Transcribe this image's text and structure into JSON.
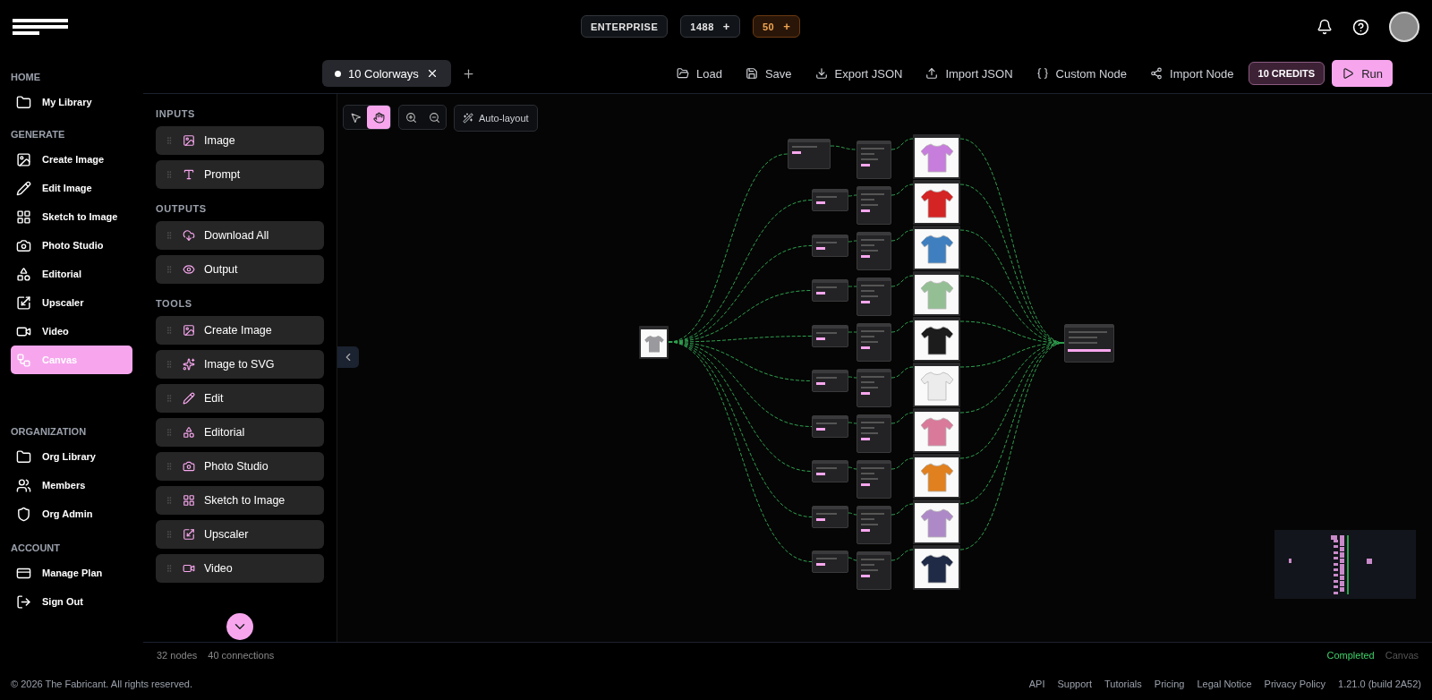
{
  "header": {
    "badges": [
      {
        "kind": "plan",
        "label": "ENTERPRISE"
      },
      {
        "kind": "credits",
        "label": "1488",
        "action": "+"
      },
      {
        "kind": "bonus",
        "label": "50",
        "action": "+"
      }
    ]
  },
  "sidebar": {
    "sections": [
      {
        "title": "HOME",
        "items": [
          {
            "label": "My Library",
            "selected": false
          }
        ]
      },
      {
        "title": "GENERATE",
        "items": [
          {
            "label": "Create Image",
            "selected": false
          },
          {
            "label": "Edit Image",
            "selected": false
          },
          {
            "label": "Sketch to Image",
            "selected": false
          },
          {
            "label": "Photo Studio",
            "selected": false
          },
          {
            "label": "Editorial",
            "selected": false
          },
          {
            "label": "Upscaler",
            "selected": false
          },
          {
            "label": "Video",
            "selected": false
          },
          {
            "label": "Canvas",
            "selected": true
          }
        ]
      },
      {
        "title": "ORGANIZATION",
        "items": [
          {
            "label": "Org Library",
            "selected": false
          },
          {
            "label": "Members",
            "selected": false
          },
          {
            "label": "Org Admin",
            "selected": false
          }
        ]
      },
      {
        "title": "ACCOUNT",
        "items": [
          {
            "label": "Manage Plan",
            "selected": false
          },
          {
            "label": "Sign Out",
            "selected": false
          }
        ]
      }
    ]
  },
  "tabs": [
    {
      "label": "10 Colorways",
      "selected": true,
      "modified": true
    }
  ],
  "actions": [
    "Load",
    "Save",
    "Export JSON",
    "Import JSON",
    "Custom Node",
    "Import Node"
  ],
  "credits": "10 CREDITS",
  "run": "Run",
  "panel": {
    "sections": [
      {
        "title": "INPUTS",
        "items": [
          "Image",
          "Prompt"
        ]
      },
      {
        "title": "OUTPUTS",
        "items": [
          "Download All",
          "Output"
        ]
      },
      {
        "title": "TOOLS",
        "items": [
          "Create Image",
          "Image to SVG",
          "Edit",
          "Editorial",
          "Photo Studio",
          "Sketch to Image",
          "Upscaler",
          "Video"
        ]
      }
    ]
  },
  "canvas_toolbar": {
    "tools": [
      {
        "kind": "select",
        "selected": false
      },
      {
        "kind": "pan",
        "selected": true
      }
    ],
    "auto_layout": "Auto-layout"
  },
  "variants": [
    {
      "color": "#c77ddb"
    },
    {
      "color": "#d42424"
    },
    {
      "color": "#3f7fbf"
    },
    {
      "color": "#94bf94"
    },
    {
      "color": "#1c1c1c"
    },
    {
      "color": "#ececec"
    },
    {
      "color": "#d97a9b"
    },
    {
      "color": "#e0801f"
    },
    {
      "color": "#ad8ac7"
    },
    {
      "color": "#1f2a47"
    }
  ],
  "status": {
    "nodes": "32 nodes",
    "connections": "40 connections",
    "state": "Completed",
    "view": "Canvas"
  },
  "footer": {
    "copyright": "© 2026 The Fabricant. All rights reserved.",
    "links": [
      "API",
      "Support",
      "Tutorials",
      "Pricing",
      "Legal Notice",
      "Privacy Policy"
    ],
    "version": "1.21.0 (build 2A52)"
  }
}
